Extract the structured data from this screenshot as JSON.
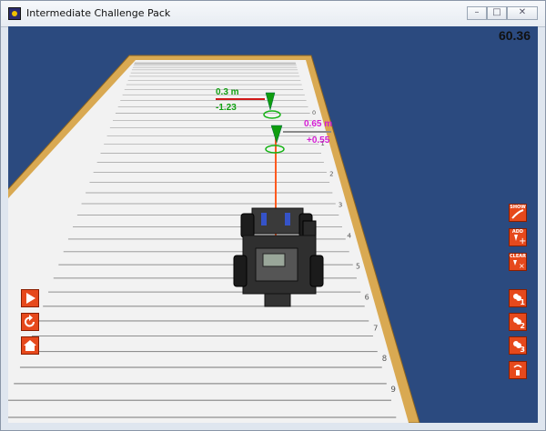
{
  "window": {
    "title": "Intermediate Challenge Pack"
  },
  "hud": {
    "timer": "60.36"
  },
  "markers": [
    {
      "distance": "0.3 m",
      "offset": "-1.23",
      "color": "#12a012"
    },
    {
      "distance": "0.65 m",
      "offset": "+0.55",
      "color": "#d41ed4"
    }
  ],
  "ruler_numbers": [
    "0",
    "1",
    "2",
    "3",
    "4",
    "5",
    "6",
    "7",
    "8",
    "9"
  ],
  "tools": {
    "show_label": "SHOW",
    "add_label": "ADD",
    "clear_label": "CLEAR",
    "camera1": "1",
    "camera2": "2",
    "camera3": "3"
  },
  "colors": {
    "sky": "#2b4a7f",
    "wood": "#d9a952",
    "table": "#f2f2f2",
    "button": "#e6491c",
    "laser": "#ff5a1e"
  }
}
